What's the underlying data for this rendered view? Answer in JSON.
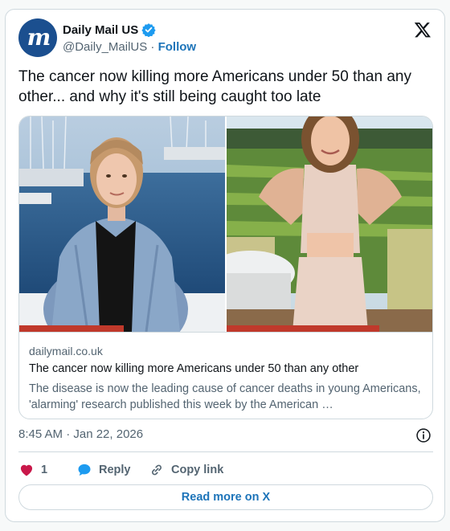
{
  "post": {
    "author_name": "Daily Mail US",
    "author_handle": "@Daily_MailUS",
    "separator": "·",
    "follow_label": "Follow",
    "avatar_letter": "m",
    "verified": true,
    "text": "The cancer now killing more Americans under 50 than any other... and why it's still being caught too late",
    "timestamp": "8:45 AM · Jan 22, 2026"
  },
  "link_card": {
    "domain": "dailymail.co.uk",
    "title": "The cancer now killing more Americans under 50 than any other",
    "description": "The disease is now the leading cause of cancer deaths in young Americans, 'alarming' research published this week by the American …",
    "images": [
      "woman-denim-jacket-marina",
      "woman-vineyard"
    ]
  },
  "actions": {
    "like_count": "1",
    "reply_label": "Reply",
    "copy_label": "Copy link"
  },
  "read_more_label": "Read more on X",
  "colors": {
    "brand_blue": "#1d74b9",
    "avatar_bg": "#1b4f8f",
    "like_pink": "#c9184a",
    "reply_blue": "#1d9bf0",
    "secondary_text": "#536471",
    "border": "#cfd9de"
  },
  "icons": {
    "verified": "verified-badge-icon",
    "x_logo": "x-logo-icon",
    "info": "info-icon",
    "like": "heart-icon",
    "reply": "reply-bubble-icon",
    "copy": "link-icon"
  }
}
